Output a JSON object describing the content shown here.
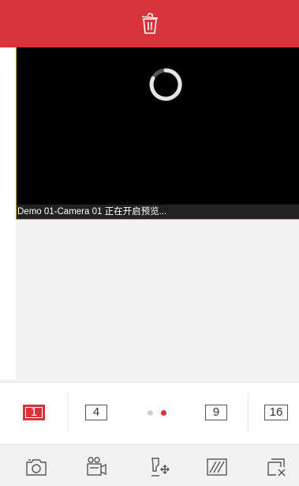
{
  "top_bar": {
    "icon": "trash-icon",
    "color": "#d7343a"
  },
  "video": {
    "caption": "Demo 01-Camera 01 正在开启预览...",
    "loading_icon": "loading-spinner-icon",
    "border_color": "#c9a227"
  },
  "layout": {
    "options": [
      "1",
      "4",
      "9",
      "16"
    ],
    "selected": "1",
    "pages": 2,
    "current_page": 2
  },
  "toolbar": {
    "icons": [
      "capture-icon",
      "record-icon",
      "ptz-icon",
      "image-quality-icon",
      "close-all-icon"
    ]
  }
}
